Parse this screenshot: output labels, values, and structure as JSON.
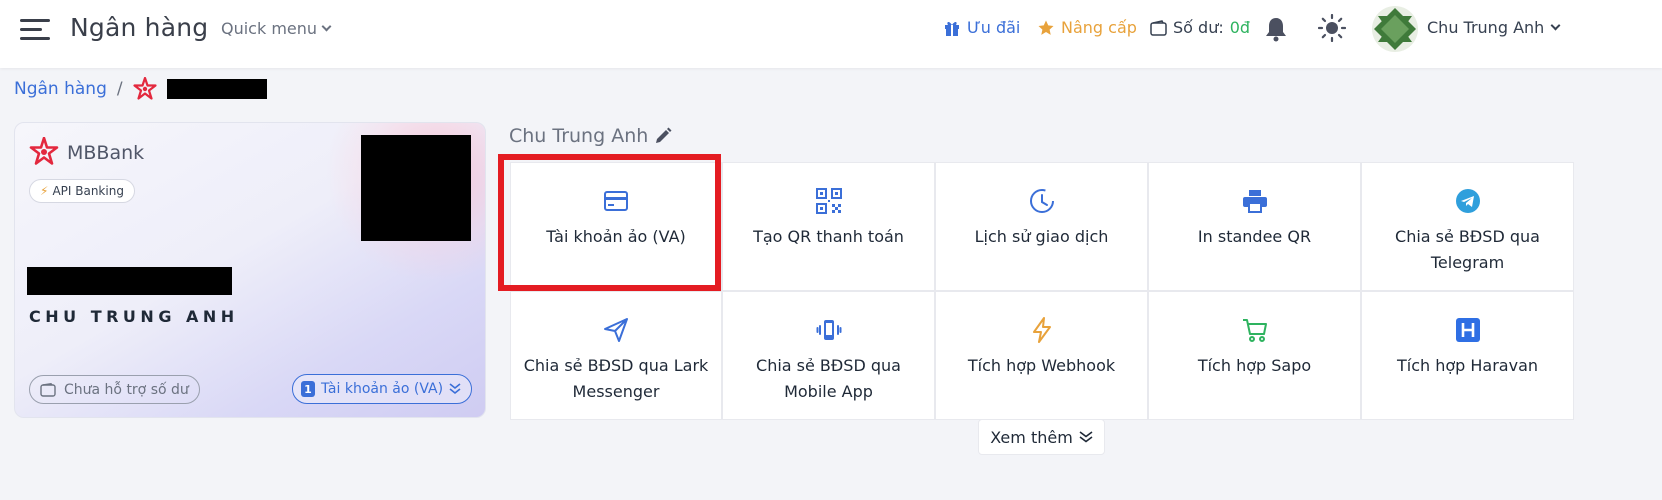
{
  "header": {
    "title": "Ngân hàng",
    "quick_menu": "Quick menu",
    "offers": "Ưu đãi",
    "upgrade": "Nâng cấp",
    "balance_label": "Số dư:",
    "balance_value": "0đ",
    "user_name": "Chu Trung Anh",
    "colors": {
      "link": "#3b6fd8",
      "upgrade": "#e8a23b",
      "balance": "#2eb35f"
    }
  },
  "breadcrumb": {
    "root": "Ngân hàng",
    "separator": "/"
  },
  "bank_card": {
    "bank_name": "MBBank",
    "badge": "API Banking",
    "holder": "CHU TRUNG ANH",
    "no_balance": "Chưa hỗ trợ số dư",
    "va_count": "1",
    "va_label": "Tài khoản ảo (VA)"
  },
  "account_title": "Chu Trung Anh",
  "tiles": [
    {
      "label": "Tài khoản ảo (VA)",
      "icon": "credit-card-icon"
    },
    {
      "label": "Tạo QR thanh toán",
      "icon": "qr-code-icon"
    },
    {
      "label": "Lịch sử giao dịch",
      "icon": "history-clock-icon"
    },
    {
      "label": "In standee QR",
      "icon": "printer-icon"
    },
    {
      "label": "Chia sẻ BĐSD qua Telegram",
      "icon": "telegram-icon"
    },
    {
      "label": "Chia sẻ BĐSD qua Lark Messenger",
      "icon": "send-icon"
    },
    {
      "label": "Chia sẻ BĐSD qua Mobile App",
      "icon": "mobile-vibrate-icon"
    },
    {
      "label": "Tích hợp Webhook",
      "icon": "lightning-icon"
    },
    {
      "label": "Tích hợp Sapo",
      "icon": "cart-icon"
    },
    {
      "label": "Tích hợp Haravan",
      "icon": "haravan-icon"
    }
  ],
  "see_more": "Xem thêm"
}
